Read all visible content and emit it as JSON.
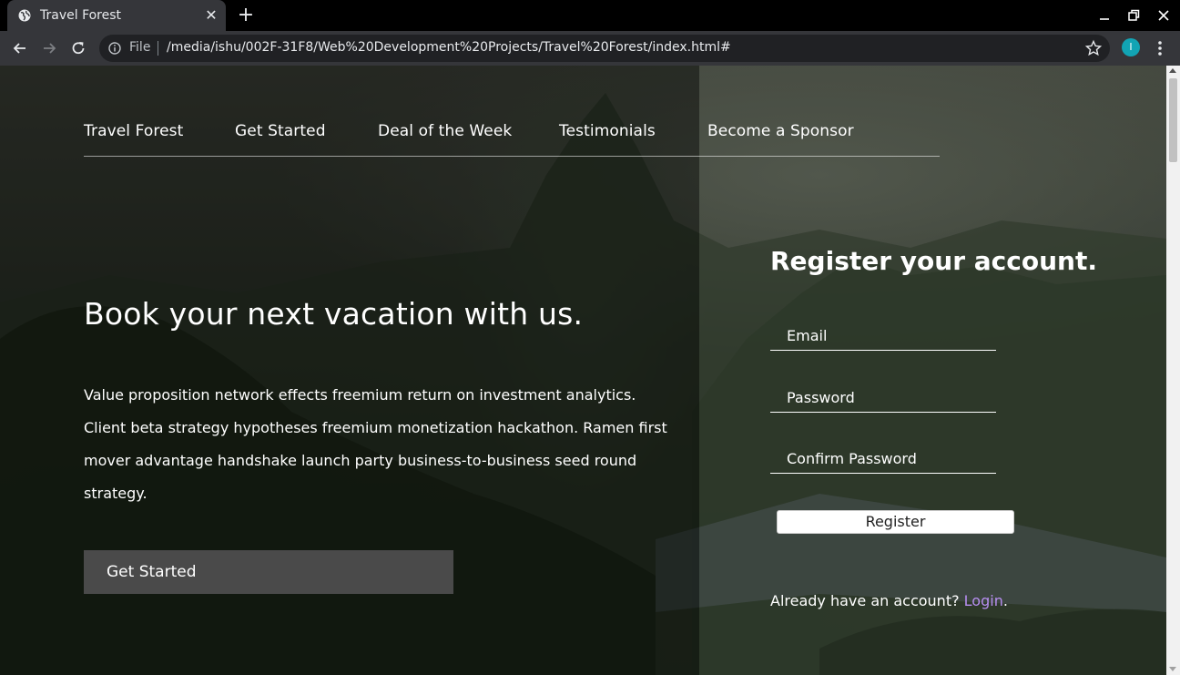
{
  "browser": {
    "tab_title": "Travel Forest",
    "url_scheme": "File",
    "url": "/media/ishu/002F-31F8/Web%20Development%20Projects/Travel%20Forest/index.html#",
    "profile_initial": "I",
    "icons": {
      "favicon": "globe-icon",
      "close": "close-icon",
      "new_tab": "plus-icon",
      "back": "back-arrow-icon",
      "forward": "forward-arrow-icon",
      "reload": "reload-icon",
      "info": "info-icon",
      "bookmark": "star-icon",
      "menu": "kebab-menu-icon"
    },
    "colors": {
      "profile_avatar": "#12a4b4"
    }
  },
  "nav": {
    "items": [
      {
        "label": "Travel Forest"
      },
      {
        "label": "Get Started"
      },
      {
        "label": "Deal of the Week"
      },
      {
        "label": "Testimonials"
      },
      {
        "label": "Become a Sponsor"
      }
    ]
  },
  "hero": {
    "title": "Book your next vacation with us.",
    "body": "Value proposition network effects freemium return on investment analytics. Client beta strategy hypotheses freemium monetization hackathon. Ramen first mover advantage handshake launch party business-to-business seed round strategy.",
    "cta_label": "Get Started"
  },
  "register": {
    "title": "Register your account.",
    "email_placeholder": "Email",
    "password_placeholder": "Password",
    "confirm_placeholder": "Confirm Password",
    "button_label": "Register",
    "login_prompt": "Already have an account? ",
    "login_link": "Login",
    "login_suffix": "."
  },
  "colors": {
    "login_link": "#b78ef0",
    "cta_background": "#4a4a4a"
  }
}
